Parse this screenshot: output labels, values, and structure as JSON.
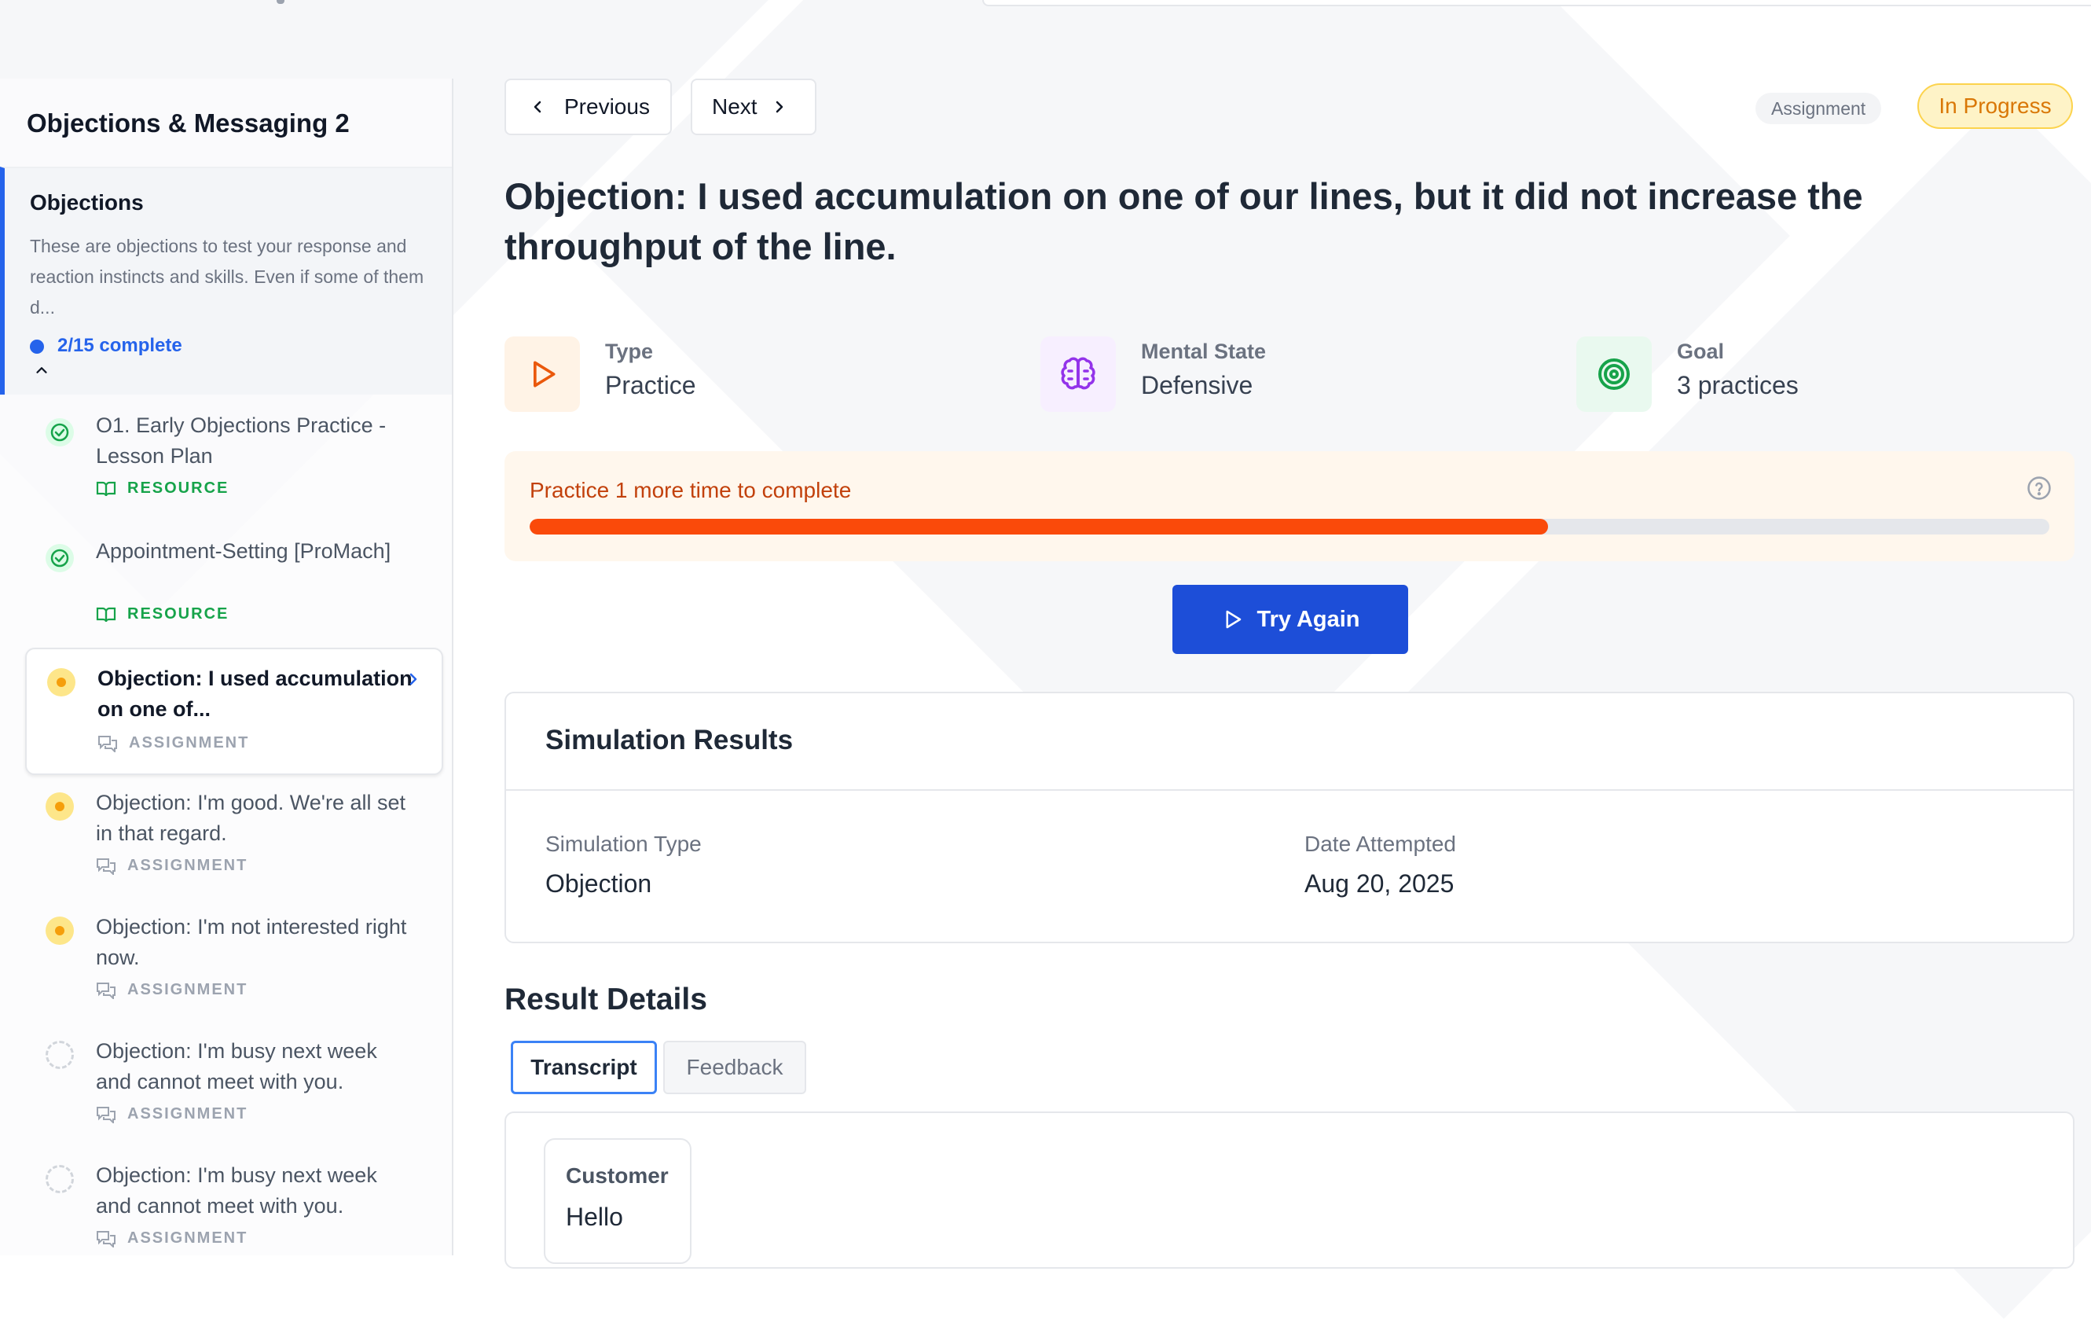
{
  "sidebar": {
    "course_title": "Objections & Messaging 2",
    "section": {
      "title": "Objections",
      "description": "These are objections to test your response and reaction instincts and skills. Even if some of them d...",
      "progress": "2/15 complete"
    },
    "items": [
      {
        "title": "O1. Early Objections Practice - Lesson Plan",
        "tag": "RESOURCE",
        "status": "completed"
      },
      {
        "title": "Appointment-Setting [ProMach]",
        "tag": "RESOURCE",
        "status": "completed"
      },
      {
        "title": "Objection: I used accumulation on one of...",
        "tag": "ASSIGNMENT",
        "status": "in-progress",
        "active": true
      },
      {
        "title": "Objection: I'm good. We're all set in that regard.",
        "tag": "ASSIGNMENT",
        "status": "in-progress"
      },
      {
        "title": "Objection: I'm not interested right now.",
        "tag": "ASSIGNMENT",
        "status": "in-progress"
      },
      {
        "title": "Objection: I'm busy next week and cannot meet with you.",
        "tag": "ASSIGNMENT",
        "status": "not-started"
      },
      {
        "title": "Objection: I'm busy next week and cannot meet with you.",
        "tag": "ASSIGNMENT",
        "status": "not-started"
      }
    ]
  },
  "nav": {
    "previous": "Previous",
    "next": "Next"
  },
  "badges": {
    "type": "Assignment",
    "status": "In Progress"
  },
  "page_title": "Objection: I used accumulation on one of our lines, but it did not increase the throughput of the line.",
  "meta": {
    "type": {
      "label": "Type",
      "value": "Practice"
    },
    "mental_state": {
      "label": "Mental State",
      "value": "Defensive"
    },
    "goal": {
      "label": "Goal",
      "value": "3 practices"
    }
  },
  "progress": {
    "text": "Practice 1 more time to complete",
    "fraction": 0.67
  },
  "try_again": "Try Again",
  "simulation": {
    "title": "Simulation Results",
    "type_label": "Simulation Type",
    "type_value": "Objection",
    "date_label": "Date Attempted",
    "date_value": "Aug 20, 2025"
  },
  "result_details": {
    "title": "Result Details",
    "tabs": [
      "Transcript",
      "Feedback"
    ],
    "transcript": [
      {
        "speaker": "Customer",
        "text": "Hello"
      }
    ]
  },
  "colors": {
    "accent": "#2563eb",
    "primary_button": "#1d4ed8",
    "progress_fill": "#fa4a0a",
    "status_badge": "#d97706",
    "resource_tag": "#16a34a"
  },
  "icons": {
    "previous": "chevron-left-icon",
    "next": "chevron-right-icon",
    "type": "play-icon",
    "mental_state": "brain-icon",
    "goal": "target-icon",
    "help": "help-circle-icon",
    "try_again": "play-icon",
    "resource": "book-open-icon",
    "assignment": "chat-icon"
  }
}
